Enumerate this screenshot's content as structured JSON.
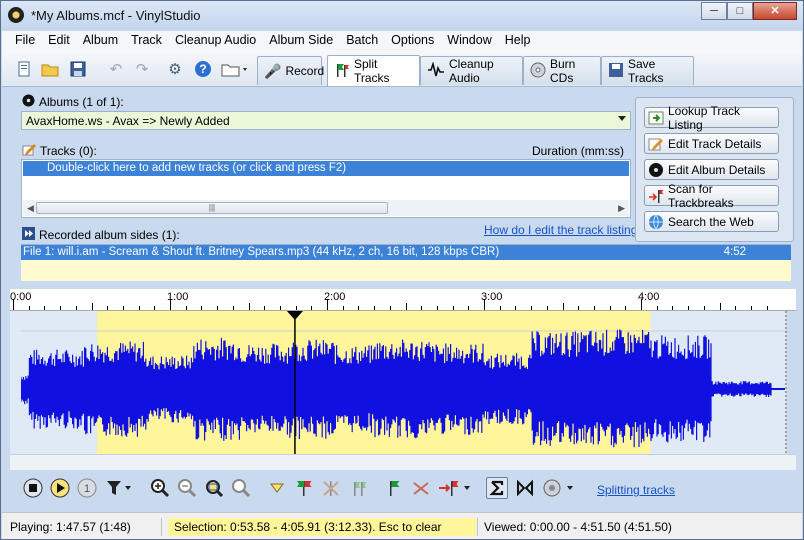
{
  "window": {
    "title": "*My Albums.mcf - VinylStudio"
  },
  "caption": {
    "minimize": "─",
    "maximize": "□",
    "close": "✕"
  },
  "menu": [
    "File",
    "Edit",
    "Album",
    "Track",
    "Cleanup Audio",
    "Album Side",
    "Batch",
    "Options",
    "Window",
    "Help"
  ],
  "toolbar": {
    "icons": [
      "new-file-icon",
      "open-folder-icon",
      "save-icon",
      "undo-icon",
      "redo-icon",
      "settings-icon",
      "help-icon",
      "folder-dropdown-icon"
    ],
    "tabs": [
      {
        "label": "Record",
        "icon": "microphone-icon"
      },
      {
        "label": "Split Tracks",
        "icon": "split-flags-icon"
      },
      {
        "label": "Cleanup Audio",
        "icon": "waveform-icon"
      },
      {
        "label": "Burn CDs",
        "icon": "cd-icon"
      },
      {
        "label": "Save Tracks",
        "icon": "save-tracks-icon"
      }
    ],
    "active_tab": "Split Tracks"
  },
  "albums": {
    "label": "Albums (1 of 1):",
    "selected": "AvaxHome.ws - Avax => Newly Added"
  },
  "tracks": {
    "label": "Tracks (0):",
    "duration_header": "Duration (mm:ss)",
    "placeholder_row": "Double-click here to add new tracks (or click and press F2)"
  },
  "recorded": {
    "label": "Recorded album sides (1):",
    "help_link": "How do I edit the track listing?",
    "rows": [
      {
        "text": "File 1: will.i.am - Scream & Shout ft. Britney Spears.mp3 (44 kHz, 2 ch, 16 bit, 128 kbps CBR)",
        "duration": "4:52"
      }
    ]
  },
  "side_buttons": [
    {
      "label": "Lookup Track Listing",
      "icon": "lookup-icon"
    },
    {
      "label": "Edit Track Details",
      "icon": "edit-icon"
    },
    {
      "label": "Edit Album Details",
      "icon": "album-icon"
    },
    {
      "label": "Scan for Trackbreaks",
      "icon": "scan-icon"
    },
    {
      "label": "Search the Web",
      "icon": "web-icon"
    }
  ],
  "timeline": {
    "labels": [
      "0:00",
      "1:00",
      "2:00",
      "3:00",
      "4:00"
    ]
  },
  "waveform": {
    "selection_start": 0.5358,
    "selection_end": 4.0591,
    "total": 4.8682,
    "playhead": 1.7957,
    "colors": {
      "wave": "#1010e0",
      "selection": "#fff59a",
      "background": "#dfeaf6"
    }
  },
  "transport": {
    "icons": [
      "stop-icon",
      "play-icon",
      "play-one-icon",
      "filter-icon",
      "zoom-in-icon",
      "zoom-out-icon",
      "zoom-selection-icon",
      "zoom-reset-icon",
      "marker-icon",
      "trackbreak-icon",
      "delete-breaks-icon",
      "auto-breaks-icon",
      "start-flag-icon",
      "remove-flag-icon",
      "end-flag-icon",
      "sigma-icon",
      "bowtie-icon",
      "speaker-icon"
    ],
    "link": "Splitting tracks"
  },
  "status": {
    "playing": "Playing: 1:47.57 (1:48)",
    "selection": "Selection: 0:53.58 - 4:05.91 (3:12.33).  Esc to clear",
    "viewed": "Viewed: 0:00.00 - 4:51.50 (4:51.50)"
  }
}
